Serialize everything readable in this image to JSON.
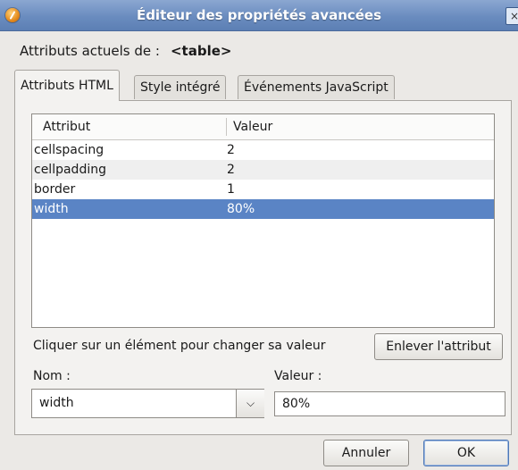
{
  "window": {
    "title": "Éditeur des propriétés avancées",
    "close_label": "×"
  },
  "current": {
    "label": "Attributs actuels de :",
    "element": "<table>"
  },
  "tabs": [
    {
      "label": "Attributs HTML",
      "active": true
    },
    {
      "label": "Style intégré",
      "active": false
    },
    {
      "label": "Événements JavaScript",
      "active": false
    }
  ],
  "table": {
    "headers": {
      "attribute": "Attribut",
      "value": "Valeur"
    },
    "rows": [
      {
        "attribute": "cellspacing",
        "value": "2"
      },
      {
        "attribute": "cellpadding",
        "value": "2"
      },
      {
        "attribute": "border",
        "value": "1"
      },
      {
        "attribute": "width",
        "value": "80%",
        "selected": true
      }
    ]
  },
  "hint": "Cliquer sur un élément pour changer sa valeur",
  "remove_button": "Enlever l'attribut",
  "name_field": {
    "label": "Nom :",
    "value": "width"
  },
  "value_field": {
    "label": "Valeur :",
    "value": "80%"
  },
  "buttons": {
    "cancel": "Annuler",
    "ok": "OK"
  },
  "colors": {
    "titlebar": "#6a8cbf",
    "selection": "#5a84c5"
  }
}
